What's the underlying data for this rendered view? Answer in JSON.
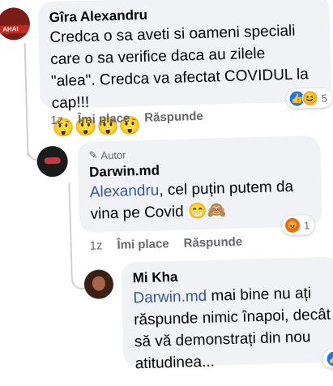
{
  "comment1": {
    "author": "Gîra Alexandru",
    "text": "Credca o sa aveti si oameni speciali care o sa verifice daca au zilele \"alea\". Credca va afectat COVIDUL la cap!!!",
    "emojis": "😲😲😲😲",
    "time": "1z",
    "like_label": "Îmi place",
    "reply_label": "Răspunde",
    "reaction_count": "5",
    "reaction_icons": [
      "like-reaction-icon",
      "haha-reaction-icon"
    ]
  },
  "comment2": {
    "author_badge": "Autor",
    "author": "Darwin.md",
    "mention": "Alexandru",
    "text": ", cel puțin putem da vina pe Covid",
    "emojis": "😁🙈",
    "time": "1z",
    "like_label": "Îmi place",
    "reply_label": "Răspunde",
    "reaction_count": "1",
    "reaction_icons": [
      "angry-reaction-icon"
    ]
  },
  "comment3": {
    "author": "Mi Kha",
    "mention": "Darwin.md",
    "text": " mai bine nu ați răspunde nimic înapoi, decât să vă demonstrați din nou atitudinea...",
    "reaction_icons": [
      "like-reaction-icon"
    ]
  },
  "colors": {
    "mention": "#385898",
    "bubble": "#f0f2f5",
    "meta": "#65676b",
    "like": "#1877f2",
    "angry": "#e9710f"
  }
}
